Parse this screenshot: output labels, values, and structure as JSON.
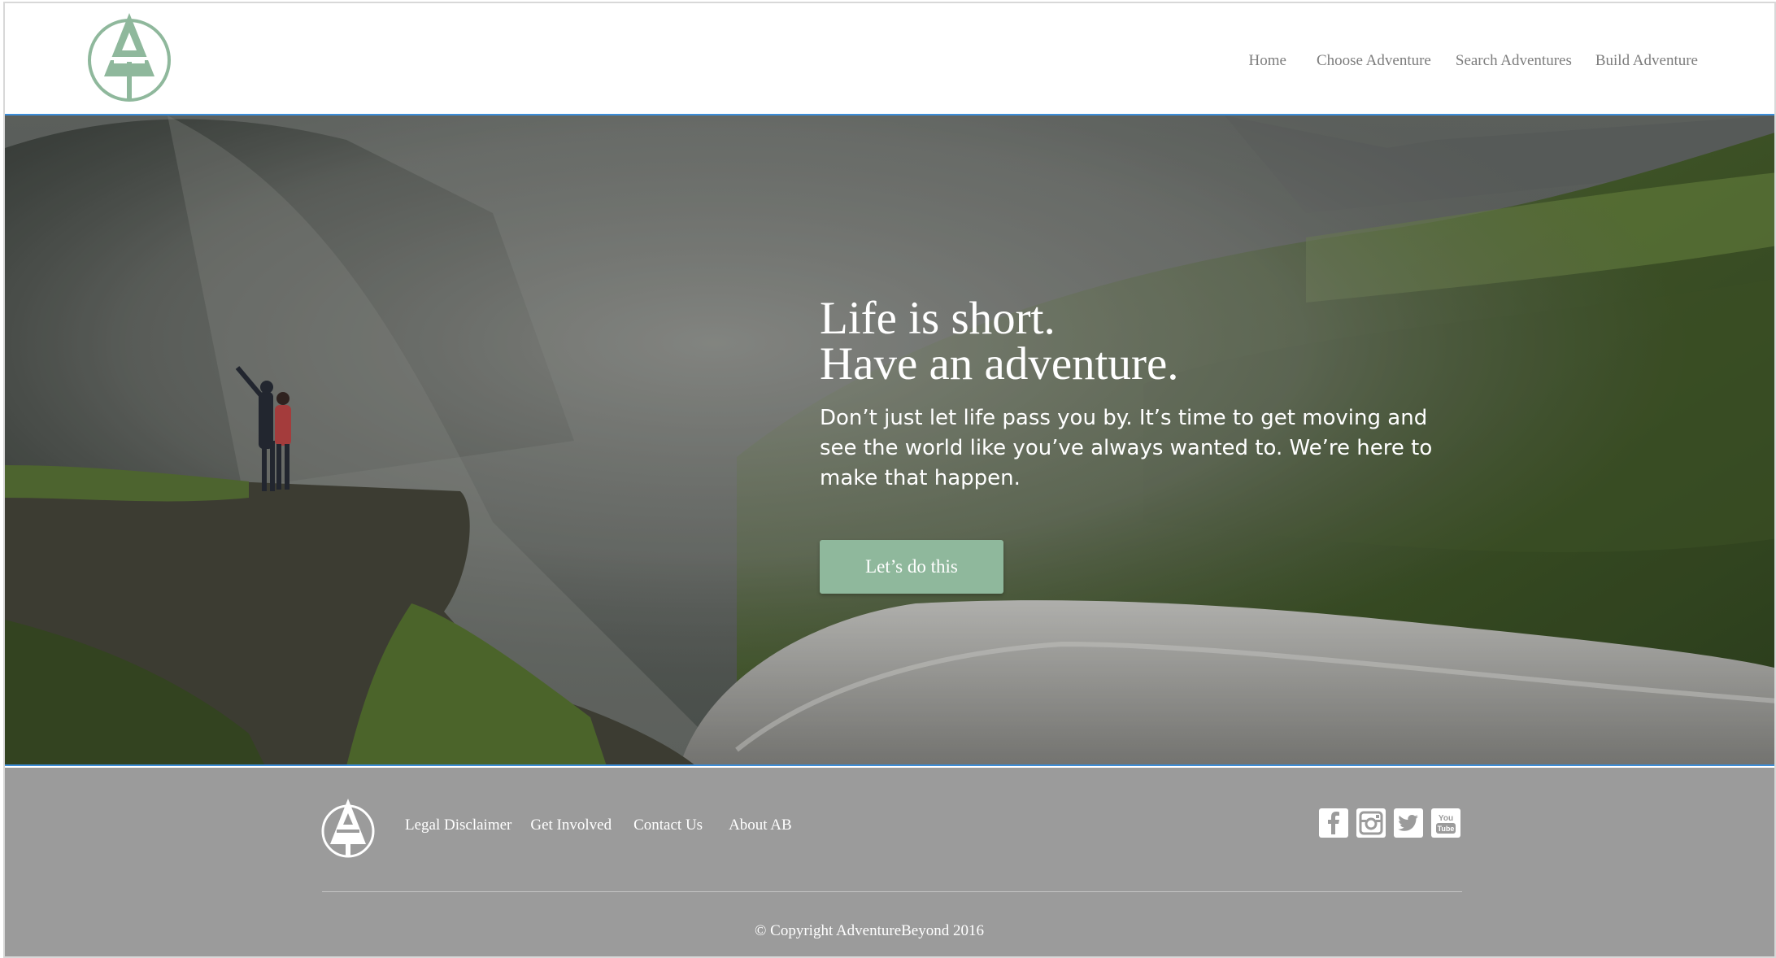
{
  "brand": {
    "accent_color": "#8fb89c",
    "logo_icon": "tree-a-logo-icon"
  },
  "nav": {
    "items": [
      {
        "label": "Home"
      },
      {
        "label": "Choose Adventure"
      },
      {
        "label": "Search Adventures"
      },
      {
        "label": "Build Adventure"
      }
    ]
  },
  "hero": {
    "headline_line1": "Life is short.",
    "headline_line2": "Have an adventure.",
    "subtext": "Don’t just let life pass you by. It’s time to get moving and see the world like you’ve always wanted to. We’re here to make that happen.",
    "cta_label": "Let’s do this",
    "image_alt": "hikers-on-cliff-by-waterfall"
  },
  "footer": {
    "links": [
      {
        "label": "Legal Disclaimer"
      },
      {
        "label": "Get Involved"
      },
      {
        "label": "Contact Us"
      },
      {
        "label": "About AB"
      }
    ],
    "social": [
      {
        "icon": "facebook-icon"
      },
      {
        "icon": "instagram-icon"
      },
      {
        "icon": "twitter-icon"
      },
      {
        "icon": "youtube-icon"
      }
    ],
    "copyright": "© Copyright AdventureBeyond 2016",
    "background": "#9b9b9b"
  }
}
